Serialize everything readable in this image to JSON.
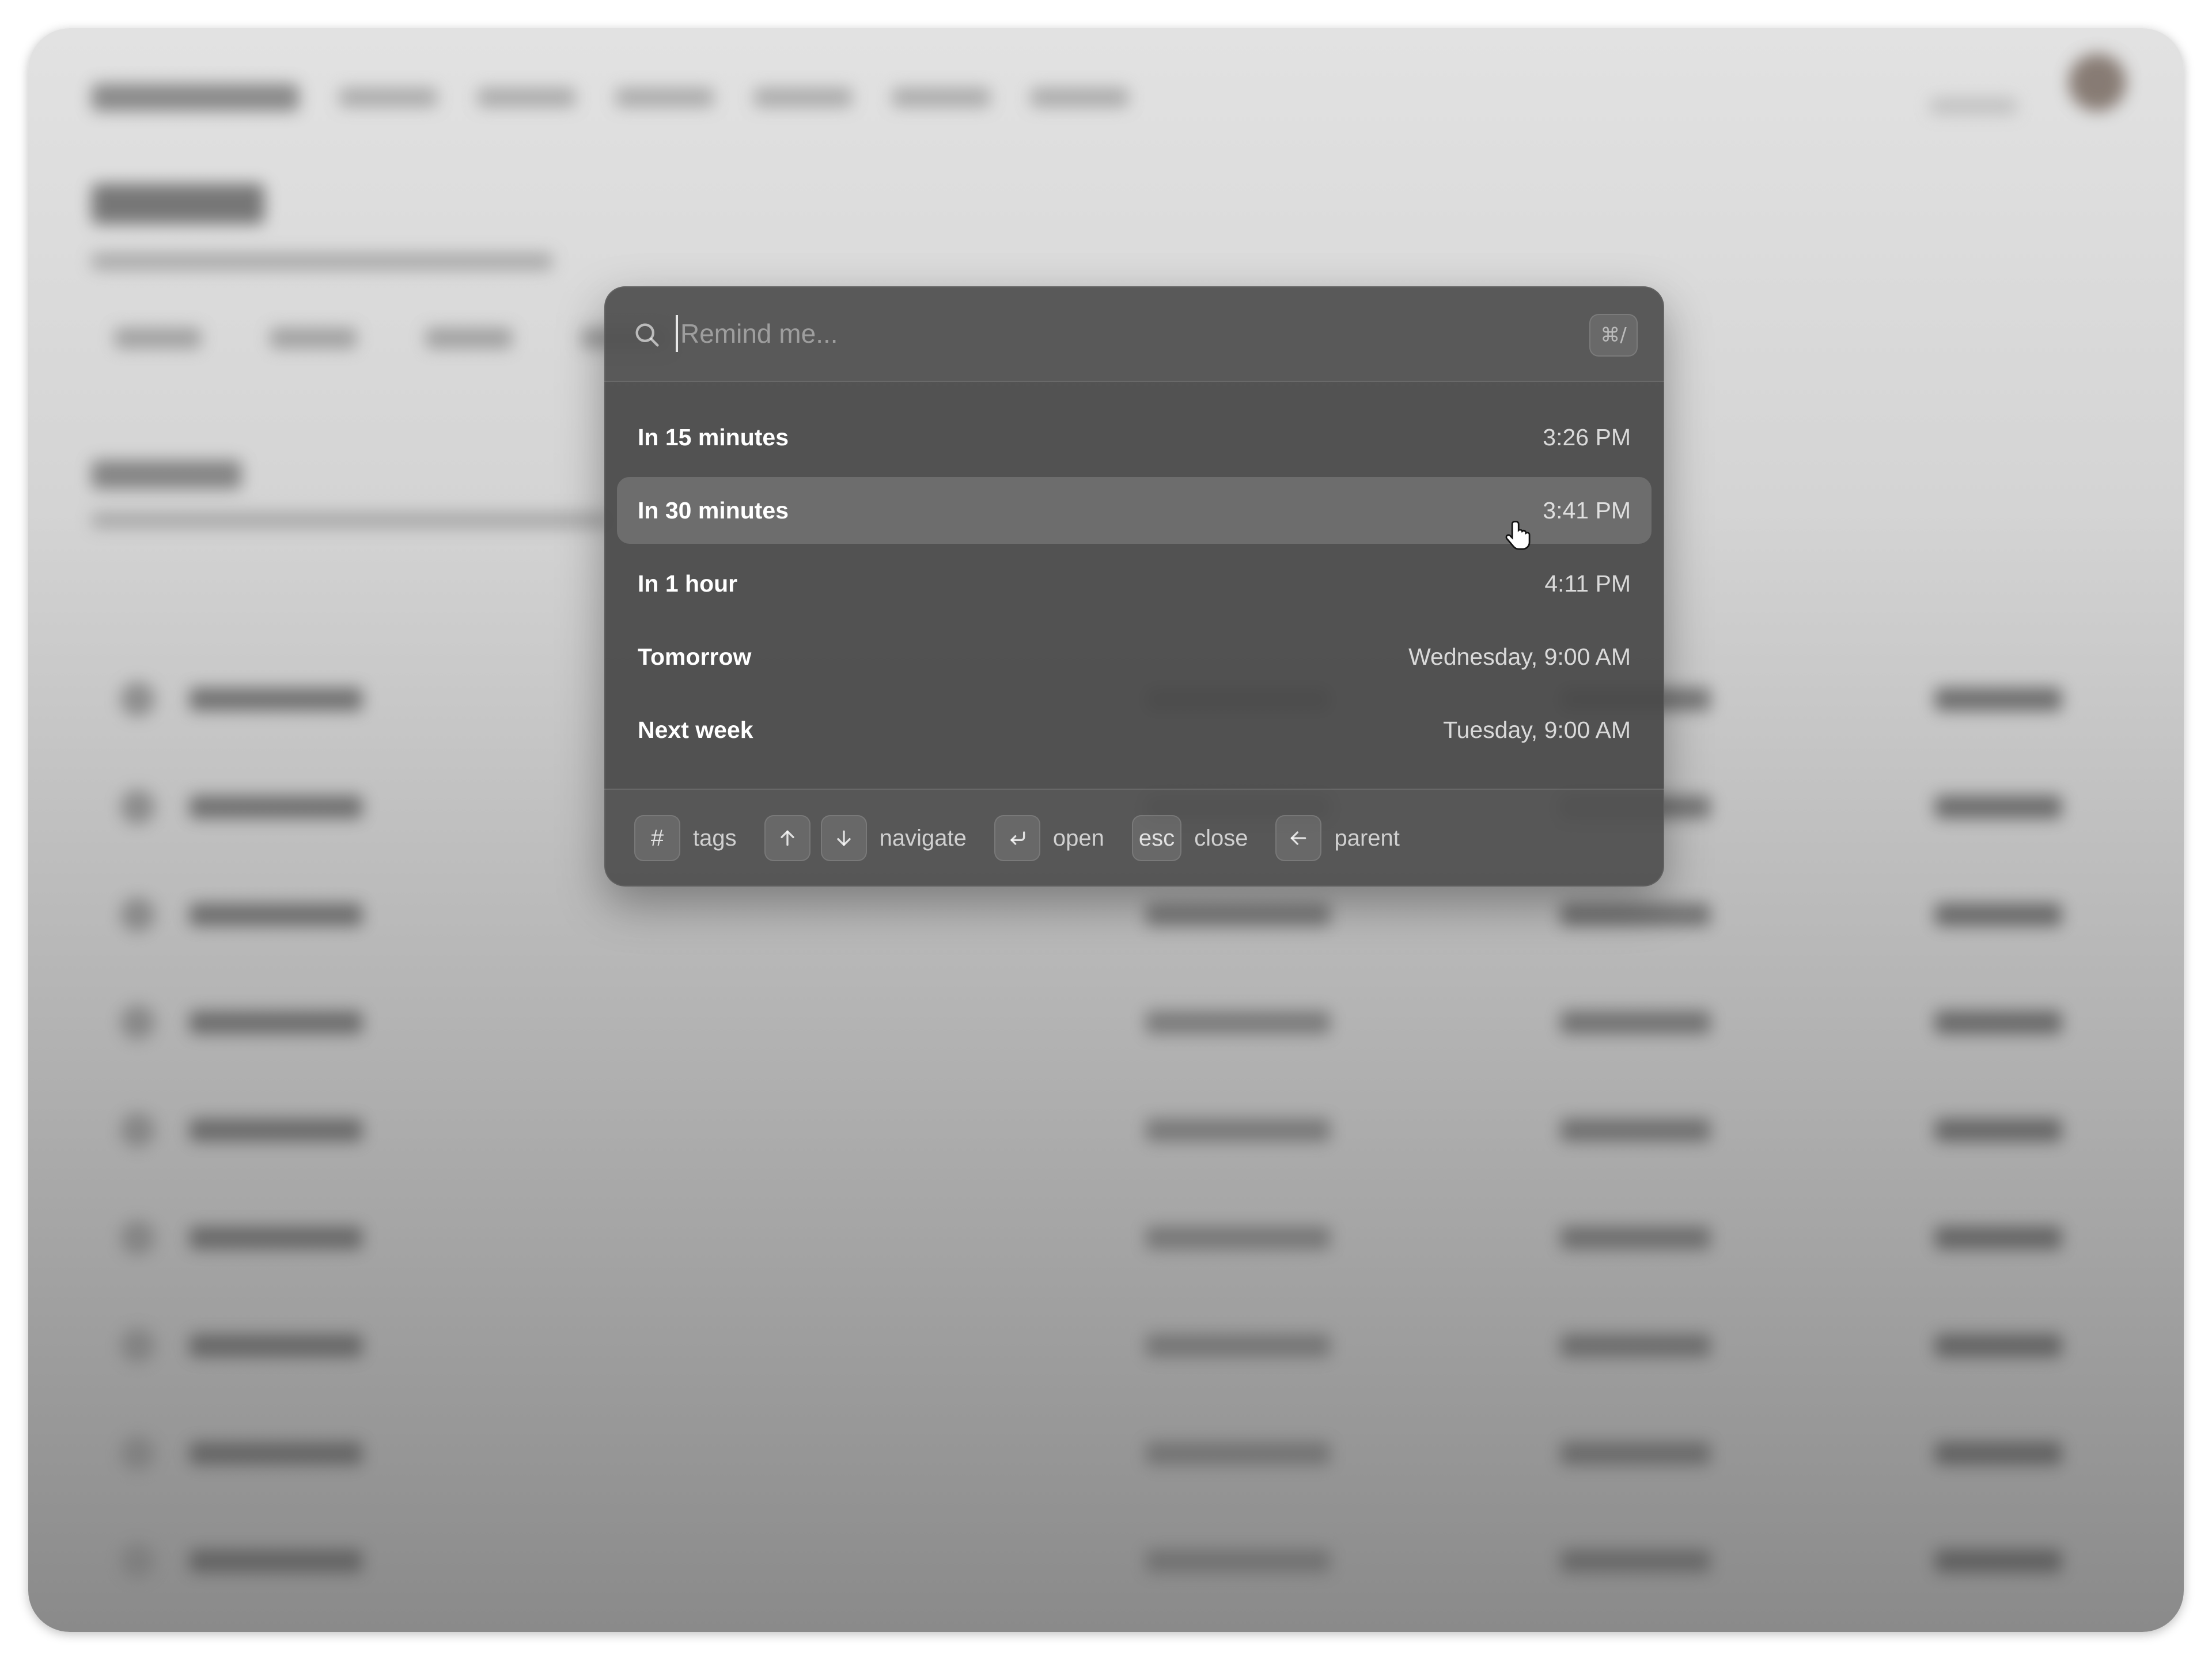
{
  "search": {
    "placeholder": "Remind me...",
    "shortcut": "⌘/"
  },
  "options": [
    {
      "label": "In 15 minutes",
      "time": "3:26 PM",
      "selected": false
    },
    {
      "label": "In 30 minutes",
      "time": "3:41 PM",
      "selected": true
    },
    {
      "label": "In 1 hour",
      "time": "4:11 PM",
      "selected": false
    },
    {
      "label": "Tomorrow",
      "time": "Wednesday, 9:00 AM",
      "selected": false
    },
    {
      "label": "Next week",
      "time": "Tuesday, 9:00 AM",
      "selected": false
    }
  ],
  "footer": {
    "tags_key": "#",
    "tags_label": "tags",
    "navigate_label": "navigate",
    "open_label": "open",
    "close_key": "esc",
    "close_label": "close",
    "parent_label": "parent"
  },
  "icons": {
    "search": "search-icon",
    "up": "arrow-up-icon",
    "down": "arrow-down-icon",
    "enter": "return-icon",
    "back": "arrow-left-icon",
    "cursor": "hand-pointer-icon"
  }
}
